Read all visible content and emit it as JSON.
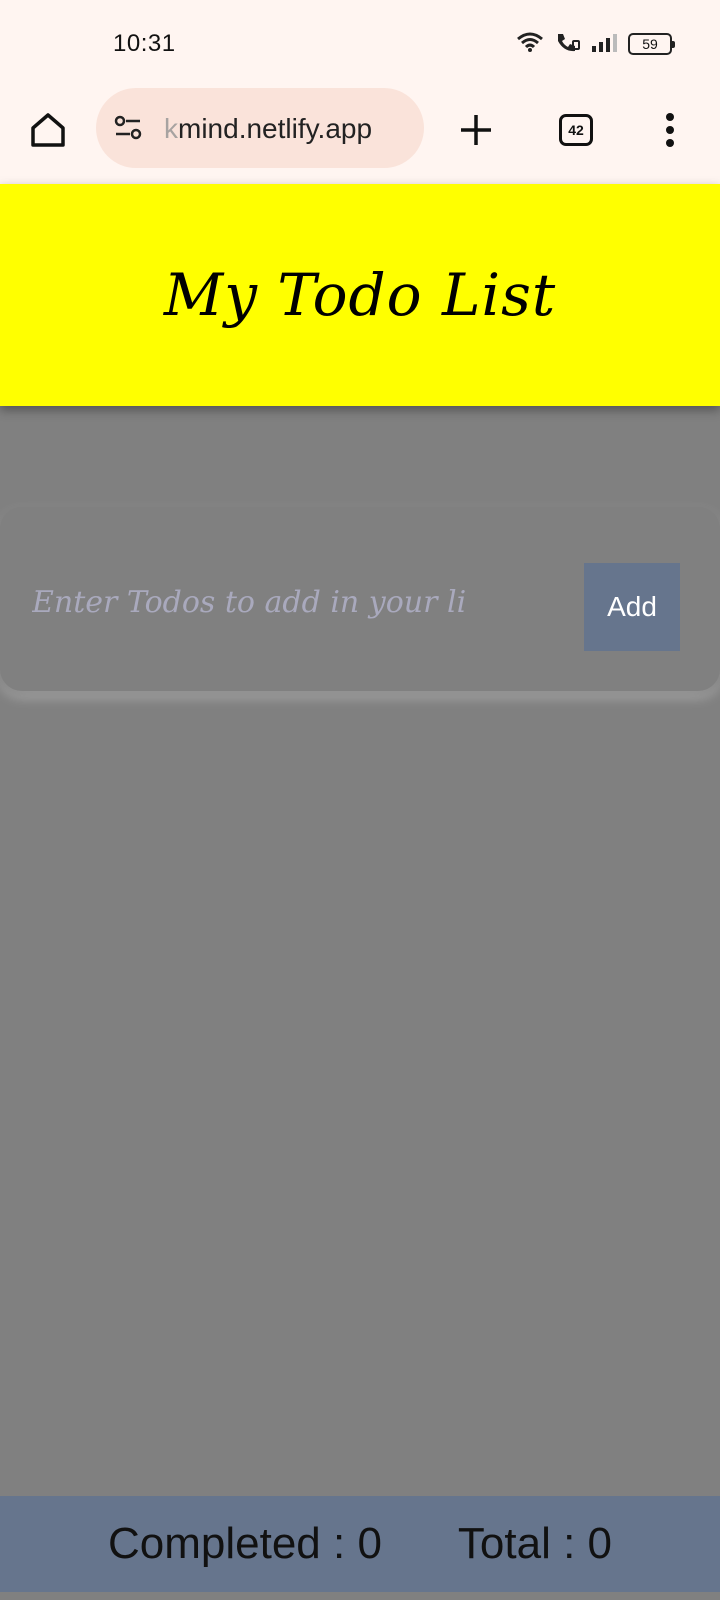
{
  "status_bar": {
    "time": "10:31",
    "battery": "59",
    "icons": [
      "wifi-icon",
      "volte-call-icon",
      "signal-icon",
      "battery-icon"
    ]
  },
  "browser": {
    "url_faded": "k",
    "url": "mind.netlify.app",
    "tab_count": "42",
    "icons": [
      "home-icon",
      "site-settings-icon",
      "plus-icon",
      "tab-switcher-icon",
      "more-vert-icon"
    ]
  },
  "app": {
    "title": "My Todo List",
    "input_placeholder": "Enter Todos to add in your li",
    "input_value": "",
    "add_label": "Add",
    "completed_label": "Completed : 0",
    "total_label": "Total : 0"
  },
  "colors": {
    "header_bg": "#ffff00",
    "page_bg": "#808080",
    "accent": "#66758d",
    "browser_bg": "#fff5f1"
  }
}
